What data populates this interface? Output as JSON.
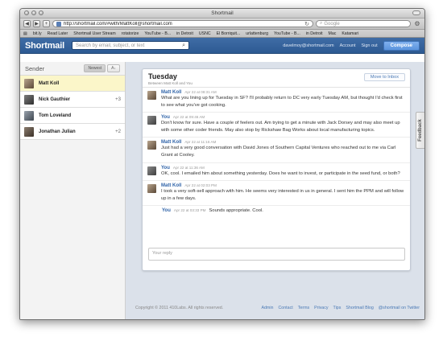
{
  "window": {
    "title": "Shortmail"
  },
  "toolbar": {
    "url": "http://shortmail.com/#with/MattKoll@shortmail.com",
    "search_placeholder": "Google"
  },
  "bookmarks": [
    "bit.ly",
    "Read Later",
    "Shortmail User Stream",
    "rotatorize",
    "YouTube - B...",
    "in Detroit",
    "USNC",
    "El Borriquit...",
    "urlattenburg",
    "YouTube - B...",
    "in Detroit",
    "Mac",
    "Katamari"
  ],
  "app": {
    "logo": "Shortmail",
    "search_placeholder": "Search by email, subject, or text",
    "user_email": "davelmoy@shortmail.com",
    "account_label": "Account",
    "signout_label": "Sign out",
    "compose_label": "Compose"
  },
  "sidebar": {
    "heading": "Sender",
    "sort_newest": "Newest",
    "sort_az": "A↓",
    "contacts": [
      {
        "name": "Matt Koll",
        "count": ""
      },
      {
        "name": "Nick Gauthier",
        "count": "+3"
      },
      {
        "name": "Tom Loveland",
        "count": ""
      },
      {
        "name": "Jonathan Julian",
        "count": "+2"
      }
    ]
  },
  "thread": {
    "day": "Tuesday",
    "between": "Between Matt Koll and You",
    "move_to_inbox": "Move to Inbox",
    "messages": [
      {
        "from": "Matt Koll",
        "time": "Apr 22 at 08:31 AM",
        "text": "What are you lining up for Tuesday in SF? I'll probably return to DC very early Tuesday AM, but thought I'd check first to see what you've got cooking."
      },
      {
        "from": "You",
        "time": "Apr 22 at 09:46 AM",
        "text": "Don't know for sure. Have a couple of feelers out. Am trying to get a minute with Jack Dorsey and may also meet up with some other coder friends. May also stop by Rickshaw Bag Works about local manufacturing topics."
      },
      {
        "from": "Matt Koll",
        "time": "Apr 22 at 11:16 AM",
        "text": "Just had a very good conversation with David Jones of Southern Capital Ventures who reached out to me via Carl Grant at Cooley."
      },
      {
        "from": "You",
        "time": "Apr 22 at 11:36 AM",
        "text": "OK, cool. I emailed him about something yesterday. Does he want to invest, or participate in the seed fund, or both?"
      },
      {
        "from": "Matt Koll",
        "time": "Apr 22 at 02:03 PM",
        "text": "I took a very soft-sell approach with him. He seems very interested in us in general. I sent him the PPM and will follow up in a few days."
      }
    ],
    "last": {
      "from": "You",
      "time": "Apr 22 at 03:33 PM",
      "text": "Sounds appropriate. Cool."
    },
    "reply_placeholder": "Your reply"
  },
  "footer": {
    "copyright": "Copyright © 2011 410Labs. All rights reserved.",
    "links": [
      "Admin",
      "Contact",
      "Terms",
      "Privacy",
      "Tips",
      "Shortmail Blog",
      "@shortmail on Twitter"
    ]
  },
  "feedback_label": "Feedback"
}
